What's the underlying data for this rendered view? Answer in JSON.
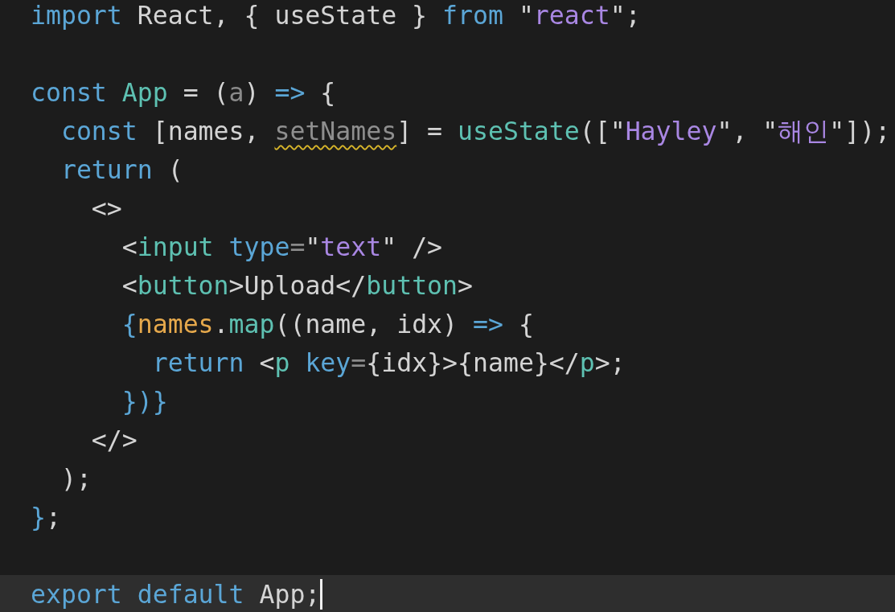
{
  "editor": {
    "lines": [
      {
        "current": false,
        "tokens": [
          {
            "kind": "keyword",
            "text": "import"
          },
          {
            "kind": "plain",
            "text": " React, { useState } "
          },
          {
            "kind": "keyword",
            "text": "from"
          },
          {
            "kind": "plain",
            "text": " \""
          },
          {
            "kind": "string",
            "text": "react"
          },
          {
            "kind": "plain",
            "text": "\";"
          }
        ]
      },
      {
        "current": false
      },
      {
        "current": false,
        "tokens": [
          {
            "kind": "keyword",
            "text": "const"
          },
          {
            "kind": "function",
            "text": " App"
          },
          {
            "kind": "plain",
            "text": " = ("
          },
          {
            "kind": "unused",
            "text": "a"
          },
          {
            "kind": "plain",
            "text": ") "
          },
          {
            "kind": "keyword",
            "text": "=>"
          },
          {
            "kind": "plain",
            "text": " {"
          }
        ]
      },
      {
        "current": false,
        "tokens": [
          {
            "kind": "keyword",
            "text": "  const"
          },
          {
            "kind": "plain",
            "text": " [names, "
          },
          {
            "kind": "warned",
            "text": "setNames"
          },
          {
            "kind": "plain",
            "text": "] = "
          },
          {
            "kind": "function",
            "text": "useState"
          },
          {
            "kind": "plain",
            "text": "([\""
          },
          {
            "kind": "string",
            "text": "Hayley"
          },
          {
            "kind": "plain",
            "text": "\", \""
          },
          {
            "kind": "string",
            "text": "해인"
          },
          {
            "kind": "plain",
            "text": "\"]);"
          }
        ]
      },
      {
        "current": false,
        "tokens": [
          {
            "kind": "keyword",
            "text": "  return"
          },
          {
            "kind": "plain",
            "text": " ("
          }
        ]
      },
      {
        "current": false,
        "tokens": [
          {
            "kind": "plain",
            "text": "    <>"
          }
        ]
      },
      {
        "current": false,
        "tokens": [
          {
            "kind": "plain",
            "text": "      <"
          },
          {
            "kind": "function",
            "text": "input"
          },
          {
            "kind": "attribute",
            "text": " type"
          },
          {
            "kind": "operator",
            "text": "="
          },
          {
            "kind": "plain",
            "text": "\""
          },
          {
            "kind": "string",
            "text": "text"
          },
          {
            "kind": "plain",
            "text": "\" />"
          }
        ]
      },
      {
        "current": false,
        "tokens": [
          {
            "kind": "plain",
            "text": "      <"
          },
          {
            "kind": "function",
            "text": "button"
          },
          {
            "kind": "plain",
            "text": ">Upload</"
          },
          {
            "kind": "function",
            "text": "button"
          },
          {
            "kind": "plain",
            "text": ">"
          }
        ]
      },
      {
        "current": false,
        "tokens": [
          {
            "kind": "keyword",
            "text": "      {"
          },
          {
            "kind": "variable",
            "text": "names"
          },
          {
            "kind": "plain",
            "text": "."
          },
          {
            "kind": "function",
            "text": "map"
          },
          {
            "kind": "plain",
            "text": "((name, idx) "
          },
          {
            "kind": "keyword",
            "text": "=>"
          },
          {
            "kind": "plain",
            "text": " {"
          }
        ]
      },
      {
        "current": false,
        "tokens": [
          {
            "kind": "keyword",
            "text": "        return"
          },
          {
            "kind": "plain",
            "text": " <"
          },
          {
            "kind": "function",
            "text": "p"
          },
          {
            "kind": "attribute",
            "text": " key"
          },
          {
            "kind": "operator",
            "text": "="
          },
          {
            "kind": "plain",
            "text": "{idx}>{name}</"
          },
          {
            "kind": "function",
            "text": "p"
          },
          {
            "kind": "plain",
            "text": ">;"
          }
        ]
      },
      {
        "current": false,
        "tokens": [
          {
            "kind": "keyword",
            "text": "      })}"
          }
        ]
      },
      {
        "current": false,
        "tokens": [
          {
            "kind": "plain",
            "text": "    </>"
          }
        ]
      },
      {
        "current": false,
        "tokens": [
          {
            "kind": "plain",
            "text": "  );"
          }
        ]
      },
      {
        "current": false,
        "tokens": [
          {
            "kind": "keyword",
            "text": "}"
          },
          {
            "kind": "plain",
            "text": ";"
          }
        ]
      },
      {
        "current": false
      },
      {
        "current": true,
        "tokens": [
          {
            "kind": "keyword",
            "text": "export default"
          },
          {
            "kind": "plain",
            "text": " App;"
          }
        ]
      }
    ]
  }
}
